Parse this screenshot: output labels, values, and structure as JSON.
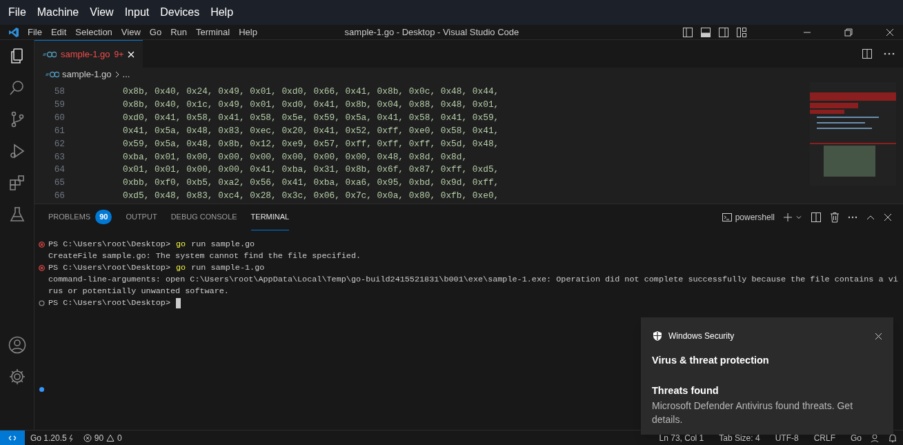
{
  "host_menu": [
    "File",
    "Machine",
    "View",
    "Input",
    "Devices",
    "Help"
  ],
  "menu": [
    "File",
    "Edit",
    "Selection",
    "View",
    "Go",
    "Run",
    "Terminal",
    "Help"
  ],
  "window": {
    "title": "sample-1.go - Desktop - Visual Studio Code"
  },
  "activity_bar": [
    {
      "kind": "files",
      "selected": true
    },
    {
      "kind": "search",
      "selected": false
    },
    {
      "kind": "git",
      "selected": false
    },
    {
      "kind": "debug",
      "selected": false
    },
    {
      "kind": "extensions",
      "selected": false
    },
    {
      "kind": "testing",
      "selected": false
    }
  ],
  "tabs": [
    {
      "label": "sample-1.go",
      "badge": "9+",
      "selected": true
    }
  ],
  "breadcrumb": {
    "file": "sample-1.go",
    "more": "..."
  },
  "editor": {
    "lines": [
      {
        "number": "58",
        "code": "0x8b, 0x40, 0x24, 0x49, 0x01, 0xd0, 0x66, 0x41, 0x8b, 0x0c, 0x48, 0x44,"
      },
      {
        "number": "59",
        "code": "0x8b, 0x40, 0x1c, 0x49, 0x01, 0xd0, 0x41, 0x8b, 0x04, 0x88, 0x48, 0x01,"
      },
      {
        "number": "60",
        "code": "0xd0, 0x41, 0x58, 0x41, 0x58, 0x5e, 0x59, 0x5a, 0x41, 0x58, 0x41, 0x59,"
      },
      {
        "number": "61",
        "code": "0x41, 0x5a, 0x48, 0x83, 0xec, 0x20, 0x41, 0x52, 0xff, 0xe0, 0x58, 0x41,"
      },
      {
        "number": "62",
        "code": "0x59, 0x5a, 0x48, 0x8b, 0x12, 0xe9, 0x57, 0xff, 0xff, 0xff, 0x5d, 0x48,"
      },
      {
        "number": "63",
        "code": "0xba, 0x01, 0x00, 0x00, 0x00, 0x00, 0x00, 0x00, 0x48, 0x8d, 0x8d,"
      },
      {
        "number": "64",
        "code": "0x01, 0x01, 0x00, 0x00, 0x41, 0xba, 0x31, 0x8b, 0x6f, 0x87, 0xff, 0xd5,"
      },
      {
        "number": "65",
        "code": "0xbb, 0xf0, 0xb5, 0xa2, 0x56, 0x41, 0xba, 0xa6, 0x95, 0xbd, 0x9d, 0xff,"
      },
      {
        "number": "66",
        "code": "0xd5, 0x48, 0x83, 0xc4, 0x28, 0x3c, 0x06, 0x7c, 0x0a, 0x80, 0xfb, 0xe0,"
      }
    ]
  },
  "panel": {
    "tabs": [
      {
        "label": "PROBLEMS",
        "badge": "90",
        "selected": false
      },
      {
        "label": "OUTPUT",
        "selected": false
      },
      {
        "label": "DEBUG CONSOLE",
        "selected": false
      },
      {
        "label": "TERMINAL",
        "selected": true
      }
    ],
    "shell": "powershell"
  },
  "terminal": [
    {
      "kind": "prompt",
      "failed": true,
      "prompt": "PS C:\\Users\\root\\Desktop>",
      "command": "go",
      "args": "run sample.go"
    },
    {
      "kind": "output",
      "text": "CreateFile sample.go: The system cannot find the file specified."
    },
    {
      "kind": "prompt",
      "failed": true,
      "prompt": "PS C:\\Users\\root\\Desktop>",
      "command": "go",
      "args": "run sample-1.go"
    },
    {
      "kind": "output",
      "text": "command-line-arguments: open C:\\Users\\root\\AppData\\Local\\Temp\\go-build2415521831\\b001\\exe\\sample-1.exe: Operation did not complete successfully because the file contains a vi"
    },
    {
      "kind": "output",
      "text": "rus or potentially unwanted software."
    },
    {
      "kind": "prompt",
      "failed": false,
      "prompt": "PS C:\\Users\\root\\Desktop>",
      "cursor": true
    }
  ],
  "toast": {
    "app": "Windows Security",
    "title": "Virus & threat protection",
    "heading": "Threats found",
    "body": "Microsoft Defender Antivirus found threats. Get details."
  },
  "status_bar": {
    "go_version": "Go 1.20.5",
    "errors": "90",
    "warnings": "0",
    "right": [
      "Ln 73, Col 1",
      "Tab Size: 4",
      "UTF-8",
      "CRLF",
      "Go"
    ]
  }
}
